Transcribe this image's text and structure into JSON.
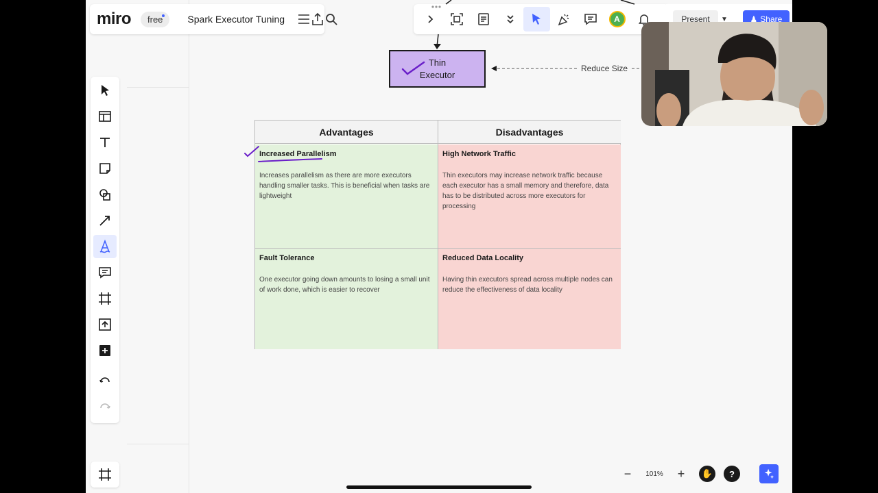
{
  "app": {
    "logo": "miro",
    "plan": "free",
    "board_title": "Spark Executor Tuning"
  },
  "toolbar_right": {
    "avatar_initial": "A",
    "present_label": "Present",
    "share_label": "Share"
  },
  "diagram": {
    "thin_executor_label_1": "Thin",
    "thin_executor_label_2": "Executor",
    "reduce_size_label": "Reduce Size"
  },
  "table": {
    "headers": [
      "Advantages",
      "Disadvantages"
    ],
    "cells": [
      {
        "title": "Increased Parallelism",
        "body": "Increases parallelism as there are more executors handling smaller tasks. This is beneficial when tasks are lightweight"
      },
      {
        "title": "High Network Traffic",
        "body": "Thin executors may increase network traffic because each executor has a small memory and therefore, data has to be distributed across more executors for processing"
      },
      {
        "title": "Fault Tolerance",
        "body": "One executor going down amounts to losing a small unit of work done, which is easier to recover"
      },
      {
        "title": "Reduced Data Locality",
        "body": "Having thin executors spread across multiple nodes can reduce the effectiveness of data locality"
      }
    ]
  },
  "zoom": {
    "level": "101%"
  },
  "colors": {
    "accent": "#4262ff",
    "advantage_bg": "#e3f2dc",
    "disadvantage_bg": "#f9d5d2",
    "executor_fill": "#ccb3f0",
    "annotation": "#6a1fc9"
  }
}
